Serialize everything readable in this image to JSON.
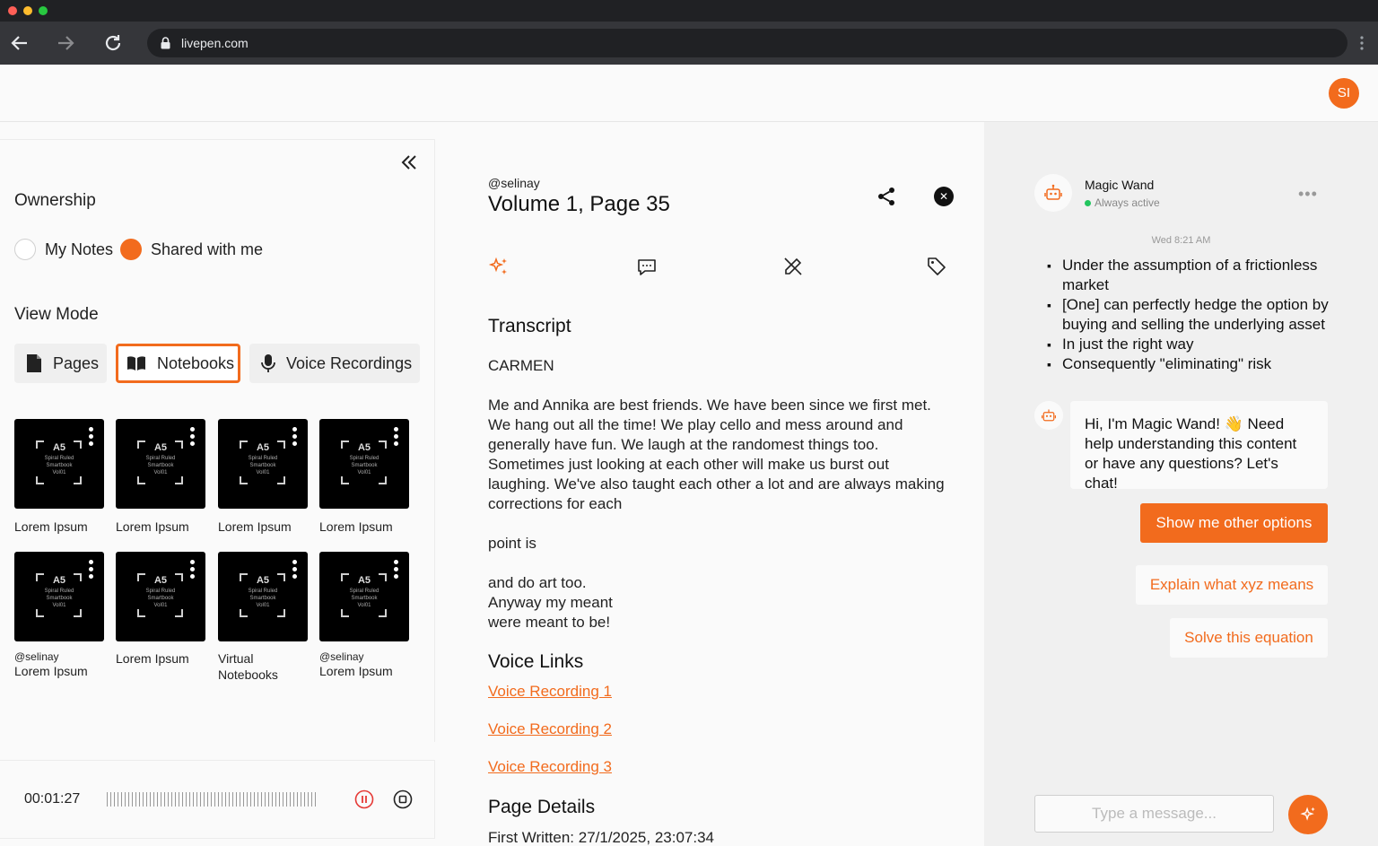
{
  "browser": {
    "url": "livepen.com"
  },
  "header": {
    "avatar_initials": "SI"
  },
  "sidebar": {
    "ownership_title": "Ownership",
    "ownership_options": [
      "My Notes",
      "Shared with me"
    ],
    "ownership_selected": "Shared with me",
    "view_mode_title": "View Mode",
    "view_modes": [
      "Pages",
      "Notebooks",
      "Voice Recordings"
    ],
    "view_mode_selected": "Notebooks",
    "thumb_title": "A5",
    "thumb_subtitle": [
      "Spiral Ruled",
      "Smartbook",
      "Vol01"
    ],
    "notebooks": [
      {
        "owner": "",
        "label": "Lorem Ipsum"
      },
      {
        "owner": "",
        "label": "Lorem Ipsum"
      },
      {
        "owner": "",
        "label": "Lorem Ipsum"
      },
      {
        "owner": "",
        "label": "Lorem Ipsum"
      },
      {
        "owner": "@selinay",
        "label": "Lorem Ipsum"
      },
      {
        "owner": "",
        "label": "Lorem Ipsum"
      },
      {
        "owner": "",
        "label": "Virtual Notebooks"
      },
      {
        "owner": "@selinay",
        "label": "Lorem Ipsum"
      }
    ]
  },
  "player": {
    "time": "00:01:27"
  },
  "document": {
    "author": "@selinay",
    "title": "Volume 1, Page 35",
    "transcript_heading": "Transcript",
    "speaker": "CARMEN",
    "paragraph1": "Me and Annika are best friends. We have been since we first met. We hang out all the time! We play cello and mess around and generally have fun. We laugh at the randomest things too. Sometimes just looking at each other will make us burst out laughing. We've also taught each other a lot and are always making corrections for each",
    "paragraph2": "point is",
    "paragraph3_lines": [
      "and do art too.",
      "Anyway my meant",
      "were meant to be!"
    ],
    "voice_links_heading": "Voice Links",
    "voice_links": [
      "Voice Recording 1",
      "Voice Recording 2",
      "Voice Recording 3"
    ],
    "page_details_heading": "Page Details",
    "first_written": "First Written: 27/1/2025, 23:07:34"
  },
  "chat": {
    "bot_name": "Magic Wand",
    "bot_status": "Always active",
    "timestamp": "Wed 8:21 AM",
    "bullets": [
      "Under the assumption of a frictionless market",
      "[One] can perfectly hedge the option by buying and selling the underlying asset",
      "In just the right way",
      "Consequently \"eliminating\" risk"
    ],
    "greeting": "Hi, I'm Magic Wand! 👋 Need help understanding this content or have any questions? Let's chat!",
    "suggestions": [
      "Show me other options",
      "Explain what xyz means",
      "Solve this equation"
    ],
    "input_placeholder": "Type a message..."
  },
  "colors": {
    "accent": "#f26b1d",
    "status_active": "#22c55e"
  }
}
